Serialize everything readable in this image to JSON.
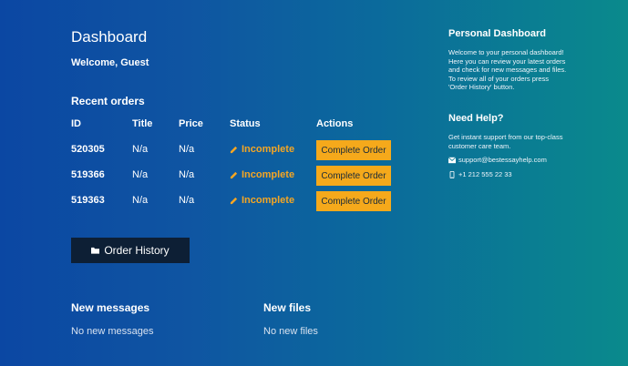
{
  "header": {
    "title": "Dashboard",
    "welcome": "Welcome, Guest"
  },
  "recent_orders": {
    "heading": "Recent orders",
    "columns": [
      "ID",
      "Title",
      "Price",
      "Status",
      "Actions"
    ],
    "rows": [
      {
        "id": "520305",
        "title": "N/a",
        "price": "N/a",
        "status": "Incomplete",
        "action": "Complete Order"
      },
      {
        "id": "519366",
        "title": "N/a",
        "price": "N/a",
        "status": "Incomplete",
        "action": "Complete Order"
      },
      {
        "id": "519363",
        "title": "N/a",
        "price": "N/a",
        "status": "Incomplete",
        "action": "Complete Order"
      }
    ]
  },
  "order_history_button": "Order History",
  "messages": {
    "heading": "New messages",
    "body": "No new messages"
  },
  "files": {
    "heading": "New files",
    "body": "No new files"
  },
  "sidebar": {
    "personal_heading": "Personal Dashboard",
    "personal_text": "Welcome to your personal dashboard! Here you can review your latest orders and check for new messages and files. To review all of your orders press 'Order History' button.",
    "help_heading": "Need Help?",
    "help_text": "Get instant support from our top-class customer care team.",
    "email": "support@bestessayhelp.com",
    "phone": "+1 212 555 22 33"
  },
  "colors": {
    "accent": "#f5a91b",
    "status_incomplete": "#f5a623",
    "history_button_bg": "#0d1f35"
  }
}
